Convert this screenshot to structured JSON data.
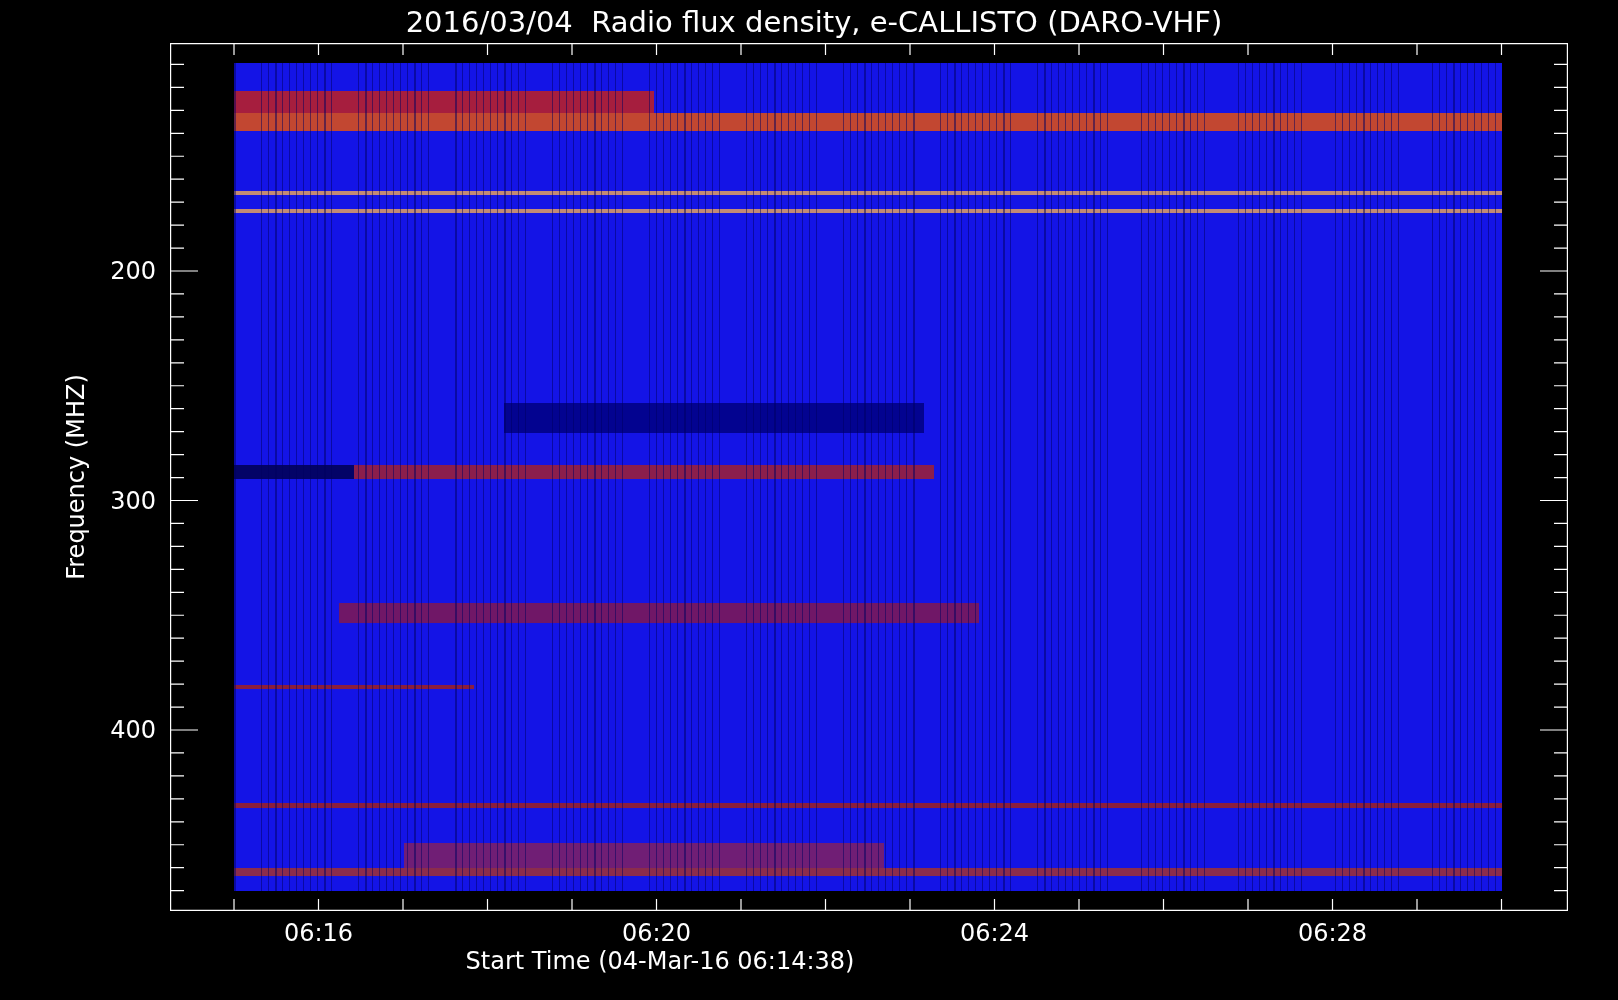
{
  "plot": {
    "title": "2016/03/04  Radio flux density, e-CALLISTO (DARO-VHF)",
    "ylabel": "Frequency (MHZ)",
    "xlabel": "Start Time (04-Mar-16 06:14:38)",
    "yticks": [
      "200",
      "300",
      "400"
    ],
    "xticks": [
      "06:16",
      "06:20",
      "06:24",
      "06:28"
    ]
  }
}
